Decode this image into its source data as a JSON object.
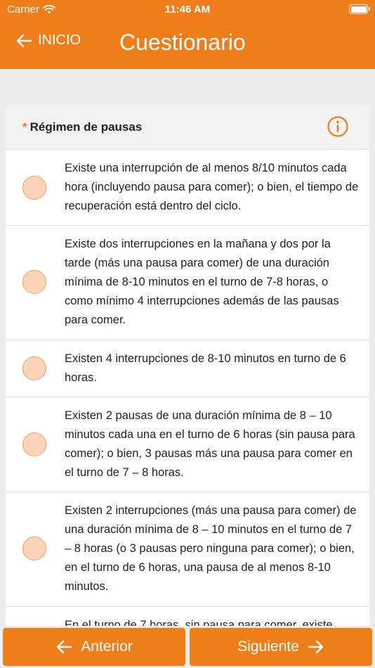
{
  "status_bar": {
    "carrier": "Carrier",
    "time": "11:46 AM"
  },
  "nav": {
    "back_label": "INICIO",
    "title": "Cuestionario"
  },
  "question": {
    "required_marker": "*",
    "title": "Régimen de pausas",
    "options": [
      {
        "label": "Existe una interrupción de al menos 8/10 minutos cada hora (incluyendo pausa para comer); o bien, el tiempo de recuperación está dentro del ciclo."
      },
      {
        "label": "Existe dos interrupciones en la mañana y dos por la tarde (más una pausa para comer) de una duración mínima de 8-10 minutos en el turno de 7-8 horas, o como mínimo 4 interrupciones además de las pausas para comer."
      },
      {
        "label": "Existen 4 interrupciones de 8-10 minutos en turno de 6 horas."
      },
      {
        "label": "Existen 2 pausas de una duración mínima de 8 – 10 minutos cada una en el turno de 6 horas (sin pausa para comer); o bien, 3 pausas más una pausa para comer en el turno de 7 – 8 horas."
      },
      {
        "label": "Existen 2 interrupciones (más una pausa para comer) de una duración mínima de 8 – 10 minutos en el turno de 7 – 8 horas (o 3 pausas pero ninguna para comer); o bien, en el turno de 6 horas, una pausa de al menos 8-10 minutos."
      },
      {
        "label": "En el turno de 7 horas, sin pausa para comer, existe"
      }
    ]
  },
  "footer": {
    "prev_label": "Anterior",
    "next_label": "Siguiente"
  },
  "colors": {
    "accent": "#ef7d1a",
    "radio_fill": "#fcd5b8"
  },
  "icons": {
    "back": "arrow-left-icon",
    "info": "info-icon",
    "next": "arrow-right-icon",
    "wifi": "wifi-icon",
    "battery": "battery-icon"
  }
}
